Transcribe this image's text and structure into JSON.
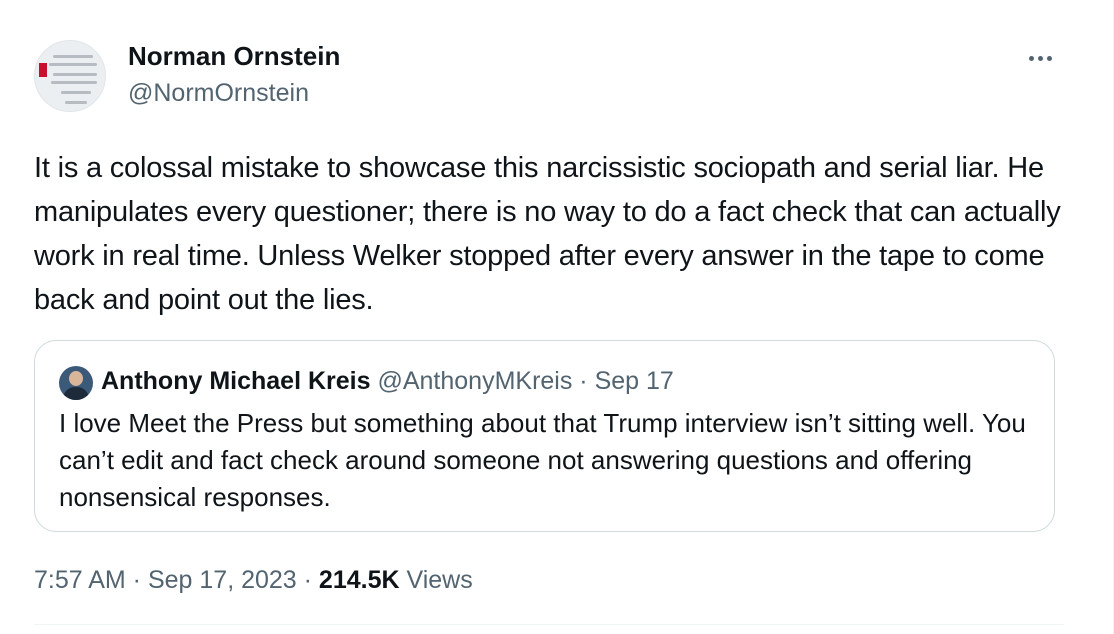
{
  "author": {
    "name": "Norman Ornstein",
    "handle": "@NormOrnstein"
  },
  "more_icon": "more-horizontal-icon",
  "tweet": {
    "text": "It is a colossal mistake to showcase this narcissistic sociopath and serial liar. He manipulates every questioner; there is no way to do a fact check that can actually work in real time. Unless Welker stopped after every answer in the tape to come back and point out the lies."
  },
  "quote": {
    "name": "Anthony Michael Kreis",
    "handle": "@AnthonyMKreis",
    "separator": " · ",
    "date": "Sep 17",
    "text": "I love Meet the Press but something about that Trump interview isn’t sitting well. You can’t edit and fact check around someone not answering questions and offering nonsensical responses."
  },
  "footer": {
    "time": "7:57 AM",
    "separator": " · ",
    "date": "Sep 17, 2023",
    "views_count": "214.5K",
    "views_label": "Views"
  },
  "colors": {
    "text_primary": "#0f1419",
    "text_secondary": "#536471",
    "border": "#cfd9de"
  }
}
